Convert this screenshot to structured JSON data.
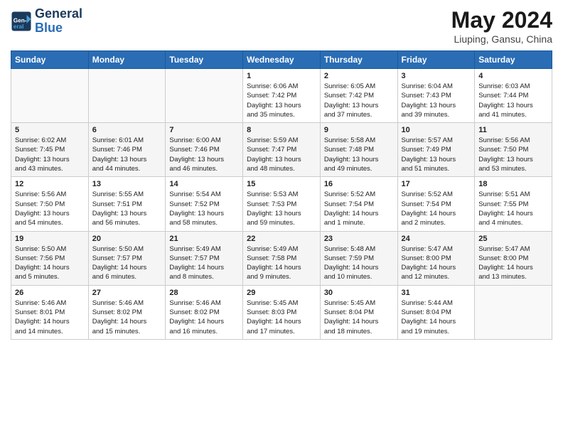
{
  "header": {
    "logo_line1": "General",
    "logo_line2": "Blue",
    "title": "May 2024",
    "subtitle": "Liuping, Gansu, China"
  },
  "weekdays": [
    "Sunday",
    "Monday",
    "Tuesday",
    "Wednesday",
    "Thursday",
    "Friday",
    "Saturday"
  ],
  "weeks": [
    [
      {
        "day": "",
        "info": ""
      },
      {
        "day": "",
        "info": ""
      },
      {
        "day": "",
        "info": ""
      },
      {
        "day": "1",
        "info": "Sunrise: 6:06 AM\nSunset: 7:42 PM\nDaylight: 13 hours\nand 35 minutes."
      },
      {
        "day": "2",
        "info": "Sunrise: 6:05 AM\nSunset: 7:42 PM\nDaylight: 13 hours\nand 37 minutes."
      },
      {
        "day": "3",
        "info": "Sunrise: 6:04 AM\nSunset: 7:43 PM\nDaylight: 13 hours\nand 39 minutes."
      },
      {
        "day": "4",
        "info": "Sunrise: 6:03 AM\nSunset: 7:44 PM\nDaylight: 13 hours\nand 41 minutes."
      }
    ],
    [
      {
        "day": "5",
        "info": "Sunrise: 6:02 AM\nSunset: 7:45 PM\nDaylight: 13 hours\nand 43 minutes."
      },
      {
        "day": "6",
        "info": "Sunrise: 6:01 AM\nSunset: 7:46 PM\nDaylight: 13 hours\nand 44 minutes."
      },
      {
        "day": "7",
        "info": "Sunrise: 6:00 AM\nSunset: 7:46 PM\nDaylight: 13 hours\nand 46 minutes."
      },
      {
        "day": "8",
        "info": "Sunrise: 5:59 AM\nSunset: 7:47 PM\nDaylight: 13 hours\nand 48 minutes."
      },
      {
        "day": "9",
        "info": "Sunrise: 5:58 AM\nSunset: 7:48 PM\nDaylight: 13 hours\nand 49 minutes."
      },
      {
        "day": "10",
        "info": "Sunrise: 5:57 AM\nSunset: 7:49 PM\nDaylight: 13 hours\nand 51 minutes."
      },
      {
        "day": "11",
        "info": "Sunrise: 5:56 AM\nSunset: 7:50 PM\nDaylight: 13 hours\nand 53 minutes."
      }
    ],
    [
      {
        "day": "12",
        "info": "Sunrise: 5:56 AM\nSunset: 7:50 PM\nDaylight: 13 hours\nand 54 minutes."
      },
      {
        "day": "13",
        "info": "Sunrise: 5:55 AM\nSunset: 7:51 PM\nDaylight: 13 hours\nand 56 minutes."
      },
      {
        "day": "14",
        "info": "Sunrise: 5:54 AM\nSunset: 7:52 PM\nDaylight: 13 hours\nand 58 minutes."
      },
      {
        "day": "15",
        "info": "Sunrise: 5:53 AM\nSunset: 7:53 PM\nDaylight: 13 hours\nand 59 minutes."
      },
      {
        "day": "16",
        "info": "Sunrise: 5:52 AM\nSunset: 7:54 PM\nDaylight: 14 hours\nand 1 minute."
      },
      {
        "day": "17",
        "info": "Sunrise: 5:52 AM\nSunset: 7:54 PM\nDaylight: 14 hours\nand 2 minutes."
      },
      {
        "day": "18",
        "info": "Sunrise: 5:51 AM\nSunset: 7:55 PM\nDaylight: 14 hours\nand 4 minutes."
      }
    ],
    [
      {
        "day": "19",
        "info": "Sunrise: 5:50 AM\nSunset: 7:56 PM\nDaylight: 14 hours\nand 5 minutes."
      },
      {
        "day": "20",
        "info": "Sunrise: 5:50 AM\nSunset: 7:57 PM\nDaylight: 14 hours\nand 6 minutes."
      },
      {
        "day": "21",
        "info": "Sunrise: 5:49 AM\nSunset: 7:57 PM\nDaylight: 14 hours\nand 8 minutes."
      },
      {
        "day": "22",
        "info": "Sunrise: 5:49 AM\nSunset: 7:58 PM\nDaylight: 14 hours\nand 9 minutes."
      },
      {
        "day": "23",
        "info": "Sunrise: 5:48 AM\nSunset: 7:59 PM\nDaylight: 14 hours\nand 10 minutes."
      },
      {
        "day": "24",
        "info": "Sunrise: 5:47 AM\nSunset: 8:00 PM\nDaylight: 14 hours\nand 12 minutes."
      },
      {
        "day": "25",
        "info": "Sunrise: 5:47 AM\nSunset: 8:00 PM\nDaylight: 14 hours\nand 13 minutes."
      }
    ],
    [
      {
        "day": "26",
        "info": "Sunrise: 5:46 AM\nSunset: 8:01 PM\nDaylight: 14 hours\nand 14 minutes."
      },
      {
        "day": "27",
        "info": "Sunrise: 5:46 AM\nSunset: 8:02 PM\nDaylight: 14 hours\nand 15 minutes."
      },
      {
        "day": "28",
        "info": "Sunrise: 5:46 AM\nSunset: 8:02 PM\nDaylight: 14 hours\nand 16 minutes."
      },
      {
        "day": "29",
        "info": "Sunrise: 5:45 AM\nSunset: 8:03 PM\nDaylight: 14 hours\nand 17 minutes."
      },
      {
        "day": "30",
        "info": "Sunrise: 5:45 AM\nSunset: 8:04 PM\nDaylight: 14 hours\nand 18 minutes."
      },
      {
        "day": "31",
        "info": "Sunrise: 5:44 AM\nSunset: 8:04 PM\nDaylight: 14 hours\nand 19 minutes."
      },
      {
        "day": "",
        "info": ""
      }
    ]
  ]
}
